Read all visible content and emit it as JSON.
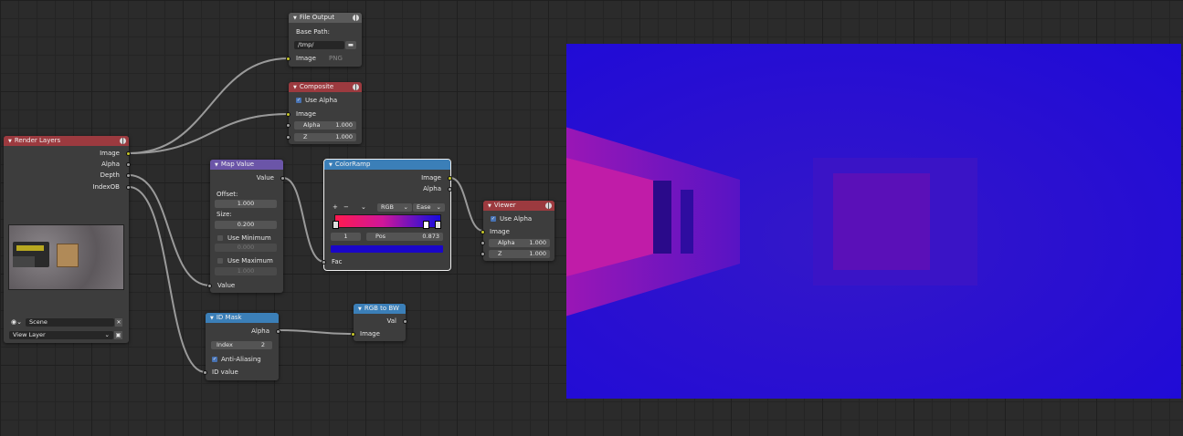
{
  "colors": {
    "render_layers_header": "#9c3a3f",
    "converter_header": "#6b55a8",
    "mask_header": "#3b7fb8",
    "output_header": "#9c3a3f",
    "socket_color": "#c7c729",
    "socket_float": "#a1a1a1",
    "socket_vector": "#6363c7",
    "preview_bg": "#2a10cf"
  },
  "file_output": {
    "title": "File Output",
    "base_path_label": "Base Path:",
    "path": "/tmp/",
    "input": "Image",
    "format": "PNG",
    "icons": [
      "folder-icon",
      "render-globe-icon"
    ]
  },
  "composite": {
    "title": "Composite",
    "use_alpha": "Use Alpha",
    "inputs": {
      "image": "Image",
      "alpha": "Alpha",
      "alpha_value": "1.000",
      "z": "Z",
      "z_value": "1.000"
    }
  },
  "render_layers": {
    "title": "Render Layers",
    "outputs": [
      "Image",
      "Alpha",
      "Depth",
      "IndexOB"
    ],
    "scene": "Scene",
    "view_layer": "View Layer"
  },
  "map_value": {
    "title": "Map Value",
    "output": "Value",
    "offset_label": "Offset:",
    "offset": "1.000",
    "size_label": "Size:",
    "size": "0.200",
    "use_minimum": "Use Minimum",
    "minimum": "0.000",
    "use_maximum": "Use Maximum",
    "maximum": "1.000",
    "input": "Value"
  },
  "color_ramp": {
    "title": "ColorRamp",
    "outputs": [
      "Image",
      "Alpha"
    ],
    "add": "+",
    "remove": "−",
    "menu": "⌄",
    "color_mode": "RGB",
    "interpolation": "Ease",
    "stop_index": "1",
    "pos_label": "Pos",
    "pos_value": "0.873",
    "input": "Fac",
    "ramp_colors": [
      "#ff1a4f",
      "#d0169a",
      "#3a10d0",
      "#1a0adc"
    ],
    "stop_color": "#1a06c8"
  },
  "viewer": {
    "title": "Viewer",
    "use_alpha": "Use Alpha",
    "inputs": {
      "image": "Image",
      "alpha": "Alpha",
      "alpha_value": "1.000",
      "z": "Z",
      "z_value": "1.000"
    }
  },
  "id_mask": {
    "title": "ID Mask",
    "output": "Alpha",
    "index_label": "Index",
    "index_value": "2",
    "anti_aliasing": "Anti-Aliasing",
    "input": "ID value"
  },
  "rgb_to_bw": {
    "title": "RGB to BW",
    "output": "Val",
    "input": "Image"
  }
}
